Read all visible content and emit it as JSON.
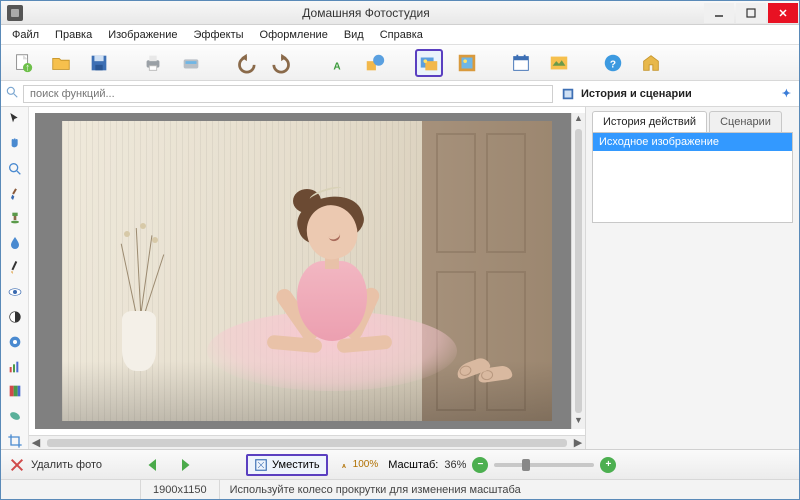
{
  "window": {
    "title": "Домашняя Фотостудия"
  },
  "menu": [
    "Файл",
    "Правка",
    "Изображение",
    "Эффекты",
    "Оформление",
    "Вид",
    "Справка"
  ],
  "toolbar": [
    {
      "name": "new-file-icon"
    },
    {
      "name": "open-icon"
    },
    {
      "name": "save-icon"
    },
    {
      "name": "print-icon"
    },
    {
      "name": "scan-icon"
    },
    {
      "name": "undo-icon"
    },
    {
      "name": "redo-icon"
    },
    {
      "name": "text-icon"
    },
    {
      "name": "shapes-icon"
    },
    {
      "name": "image-layer-icon",
      "selected": true
    },
    {
      "name": "frame-icon"
    },
    {
      "name": "calendar-icon"
    },
    {
      "name": "postcard-icon"
    },
    {
      "name": "help-icon"
    },
    {
      "name": "home-icon"
    }
  ],
  "search": {
    "placeholder": "поиск функций..."
  },
  "right": {
    "header": "История и сценарии",
    "tabs": {
      "history": "История действий",
      "scenarios": "Сценарии"
    },
    "history_items": [
      "Исходное изображение"
    ]
  },
  "left_tools": [
    "pointer-icon",
    "hand-icon",
    "zoom-icon",
    "brush-icon",
    "clone-stamp-icon",
    "blur-icon",
    "pencil-icon",
    "eye-red-icon",
    "contrast-icon",
    "sharpen-icon",
    "levels-icon",
    "gradient-icon",
    "heal-icon",
    "crop-icon"
  ],
  "bottom": {
    "delete": "Удалить фото",
    "fit": "Уместить",
    "hundred": "100%",
    "scale_label": "Масштаб:",
    "scale_value": "36%"
  },
  "status": {
    "dimensions": "1900x1150",
    "hint": "Используйте колесо прокрутки для изменения масштаба"
  },
  "colors": {
    "accent": "#3399ff",
    "selected_border": "#5a3fc0"
  }
}
